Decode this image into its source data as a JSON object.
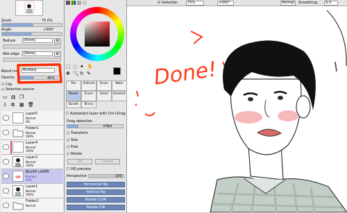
{
  "navigator": {
    "zoom_label": "Zoom",
    "zoom_value": "75.0%",
    "angle_label": "Angle",
    "angle_value": "+000°"
  },
  "texture": {
    "label": "Texture",
    "value": "[None]"
  },
  "wet_edge": {
    "label": "Wet edge",
    "value": "[None]"
  },
  "blend": {
    "label": "Blend mo",
    "value": "Multiply"
  },
  "opacity": {
    "label": "Opacity",
    "value": "40%",
    "level": 0.4
  },
  "options": {
    "clipping_label": "Clip",
    "selection_source_label": "Selection source"
  },
  "layers": [
    {
      "name": "Layer5",
      "mode": "Normal",
      "opacity": "0%"
    },
    {
      "name": "Folder1",
      "mode": "Normal",
      "opacity": "100%"
    },
    {
      "name": "Layer4",
      "mode": "Normal",
      "opacity": "100%"
    },
    {
      "name": "Layer2",
      "mode": "Normal",
      "opacity": "100%"
    },
    {
      "name": "BLUSH LAYER",
      "mode": "Multiply",
      "opacity": "40%"
    },
    {
      "name": "Layer1",
      "mode": "Normal",
      "opacity": "100%"
    },
    {
      "name": "Folder2",
      "mode": "Normal",
      "opacity": ""
    }
  ],
  "tools": [
    {
      "label": "Pen"
    },
    {
      "label": "AirBrush"
    },
    {
      "label": "Brush"
    },
    {
      "label": "Water"
    },
    {
      "label": "Marker"
    },
    {
      "label": "Eraser"
    },
    {
      "label": "Select"
    },
    {
      "label": "Deselect"
    },
    {
      "label": "Bucket"
    },
    {
      "label": "Binary"
    }
  ],
  "transform": {
    "autoselect_label": "Autoselect layer with Ctrl+Drag",
    "drag_label": "Drag detection",
    "drag_value": "±4px",
    "opts": [
      "Transform",
      "Size",
      "Free",
      "Rotate"
    ],
    "ok_label": "OK",
    "cancel_label": "Cancel",
    "hq_label": "HQ preview",
    "perspective_label": "Perspective",
    "perspective_value": "100",
    "buttons": [
      "Horizontal flip",
      "Vertical flip",
      "Rotate CCW",
      "Rotate CW"
    ]
  },
  "topbar": {
    "selection_label": "Selection",
    "zoom": "75%",
    "angle": "+000°",
    "mode": "Normal",
    "smoothing_label": "Smoothing",
    "smoothing_value": "S-3"
  },
  "canvas": {
    "done_text": "Done!",
    "colors": {
      "done": "#ff3b1a",
      "blush": "#f08a8a",
      "hair": "#111111",
      "shirt": "#c3cfc6"
    }
  },
  "colors": {
    "primary": "#000000",
    "secondary": "#ffffff",
    "accent": "#6b87b8",
    "annotation": "#ff2a00"
  }
}
